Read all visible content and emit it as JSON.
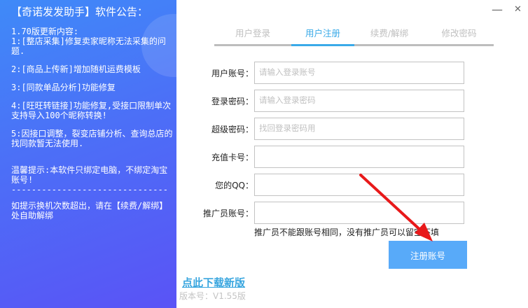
{
  "notice": {
    "title": "【奇诺发发助手】软件公告：",
    "paragraphs": [
      "1.70版更新内容:\n1:[整店采集]修复卖家昵称无法采集的问题.",
      "2:[商品上传新]增加随机运费模板",
      "3:[同款单品分析]功能修复",
      "4:[旺旺转链接]功能修复,受接口限制单次支持导入100个昵称转换!",
      "5:因接口调整，裂变店铺分析、查询总店的找同款暂无法使用.",
      "\n温馨提示:本软件只绑定电脑，不绑定淘宝账号!\n-------------------------------",
      "\n如提示换机次数超出，请在【续费/解绑】处自助解绑"
    ]
  },
  "window": {
    "minimize": "—",
    "close": "✕"
  },
  "tabs": [
    {
      "label": "用户登录"
    },
    {
      "label": "用户注册"
    },
    {
      "label": "续费/解绑"
    },
    {
      "label": "修改密码"
    }
  ],
  "form": {
    "fields": [
      {
        "label": "用户账号：",
        "placeholder": "请输入登录账号"
      },
      {
        "label": "登录密码：",
        "placeholder": "请输入登录密码"
      },
      {
        "label": "超级密码：",
        "placeholder": "找回登录密码用"
      },
      {
        "label": "充值卡号：",
        "placeholder": ""
      },
      {
        "label": "您的QQ：",
        "placeholder": ""
      },
      {
        "label": "推广员账号：",
        "placeholder": ""
      }
    ],
    "hint": "推广员不能跟账号相同，没有推广员可以留空不填",
    "submit": "注册账号"
  },
  "footer": {
    "download_link": "点此下载新版",
    "version": "版本号：V1.55版"
  },
  "colors": {
    "accent": "#3aaae8",
    "button": "#58aaf9",
    "arrow": "#e8191a"
  }
}
